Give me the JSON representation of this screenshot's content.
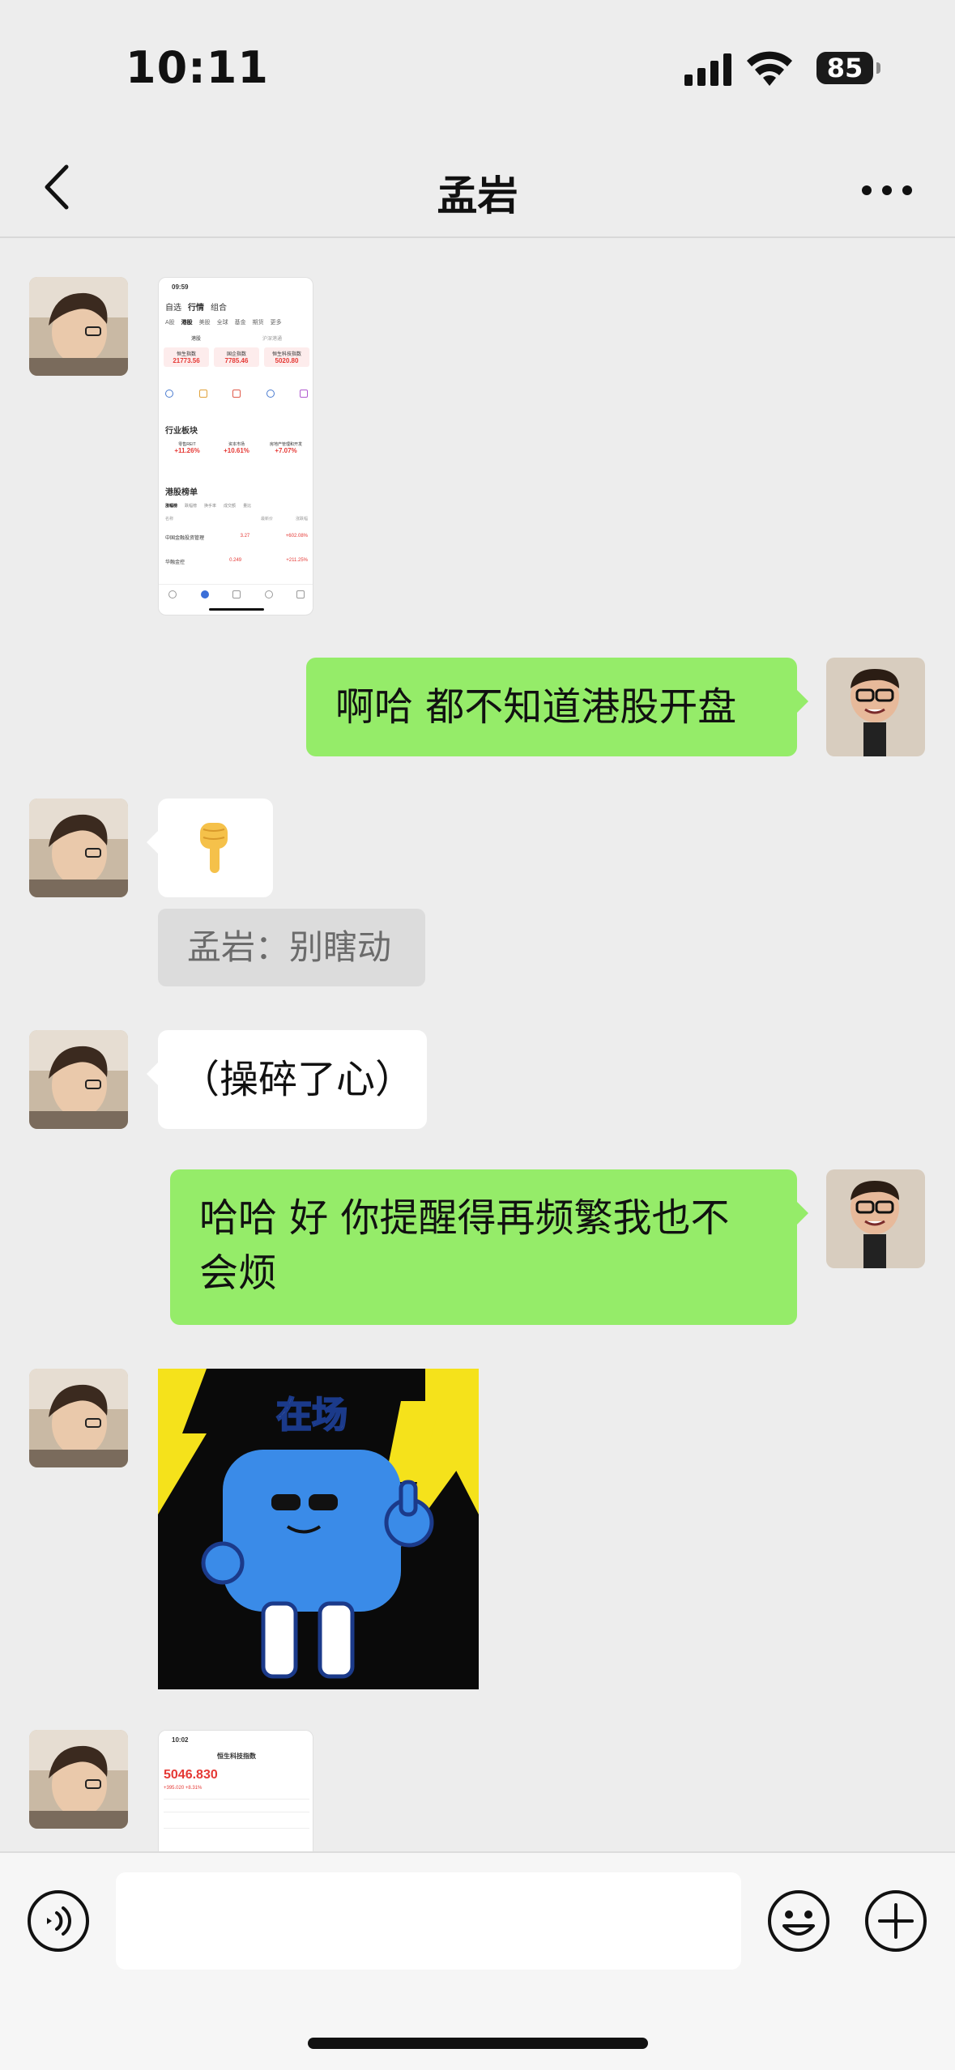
{
  "status_bar": {
    "time": "10:11",
    "battery": "85"
  },
  "nav": {
    "title": "孟岩"
  },
  "messages": {
    "m2_text": "啊哈 都不知道港股开盘",
    "m3_quote": "孟岩：别瞎动",
    "m4_text": "（操碎了心）",
    "m5_text": "哈哈 好 你提醒得再频繁我也不会烦",
    "m6_sticker_text": "在场"
  },
  "screenshot1": {
    "time": "09:59",
    "tabs": [
      "自选",
      "行情",
      "组合"
    ],
    "markets": [
      "A股",
      "港股",
      "美股",
      "全球",
      "基金",
      "期货",
      "更多"
    ],
    "sub_tabs": [
      "港股",
      "沪深港通"
    ],
    "indices": [
      {
        "name": "恒生指数",
        "value": "21773.56"
      },
      {
        "name": "国企指数",
        "value": "7785.46"
      },
      {
        "name": "恒生科技指数",
        "value": "5020.80"
      }
    ],
    "section_industry": "行业板块",
    "industries": [
      {
        "name": "零售REIT",
        "pct": "+11.26%"
      },
      {
        "name": "资本市场",
        "pct": "+10.61%"
      },
      {
        "name": "房地产管理和开发",
        "pct": "+7.07%"
      }
    ],
    "section_rank": "港股榜单",
    "rank_tabs": [
      "涨幅榜",
      "跌幅榜",
      "换手率",
      "成交额",
      "量比"
    ],
    "rank_headers": [
      "名称",
      "最新价",
      "涨跌幅"
    ],
    "rank_rows": [
      {
        "name": "中国金融投资管理",
        "price": "3.27",
        "pct": "+602.08%"
      },
      {
        "name": "华融金控",
        "price": "0.249",
        "pct": "+211.25%"
      }
    ]
  },
  "screenshot2": {
    "time": "10:02",
    "title": "恒生科技指数",
    "value": "5046.830",
    "change": "+395.020 +8.31%"
  },
  "colors": {
    "green_bubble": "#95ec69",
    "background": "#ededed",
    "stock_up": "#e53935"
  },
  "icons": [
    "back-icon",
    "more-icon",
    "voice-icon",
    "emoji-icon",
    "plus-icon"
  ]
}
